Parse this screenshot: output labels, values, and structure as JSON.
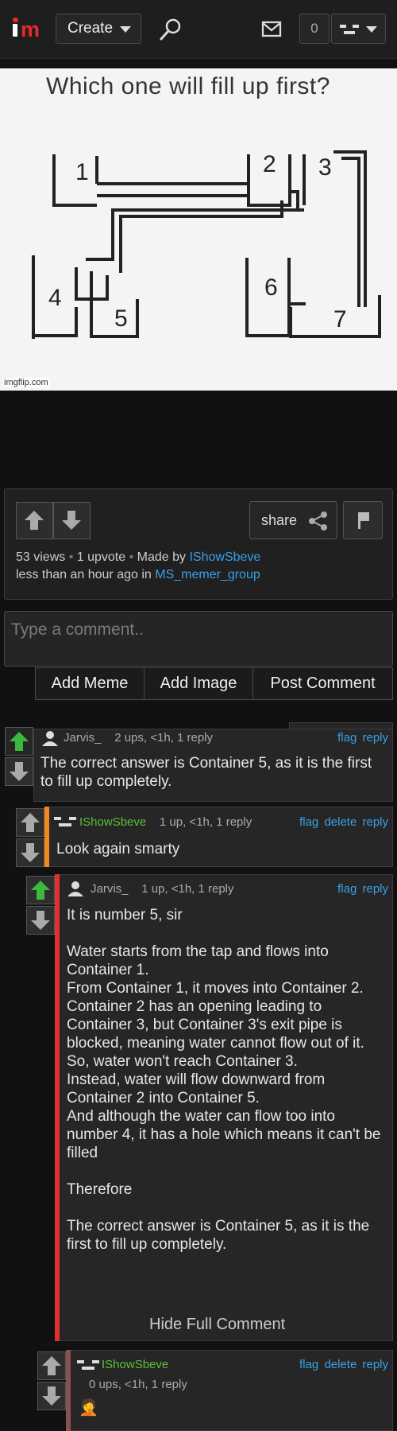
{
  "topbar": {
    "create_label": "Create",
    "notifications_count": "0"
  },
  "meme": {
    "title": "Which one will fill up first?",
    "watermark": "imgflip.com",
    "container_numbers": [
      "1",
      "2",
      "3",
      "4",
      "5",
      "6",
      "7"
    ]
  },
  "post_info": {
    "share_label": "share",
    "views": "53 views",
    "upvotes": "1 upvote",
    "made_by_prefix": "Made by",
    "author": "IShowSbeve",
    "time_prefix": "less than an hour ago in",
    "stream": "MS_memer_group"
  },
  "comment_box": {
    "placeholder": "Type a comment..",
    "add_meme": "Add Meme",
    "add_image": "Add Image",
    "post_comment": "Post Comment"
  },
  "comments": [
    {
      "user": "Jarvis_",
      "meta": "2 ups, <1h, 1 reply",
      "actions": [
        "flag",
        "reply"
      ],
      "text": "The correct answer is Container 5, as it is the first to fill up completely."
    },
    {
      "user": "IShowSbeve",
      "meta": "1 up, <1h, 1 reply",
      "actions": [
        "flag",
        "delete",
        "reply"
      ],
      "text": "Look again smarty"
    },
    {
      "user": "Jarvis_",
      "meta": "1 up, <1h, 1 reply",
      "actions": [
        "flag",
        "reply"
      ],
      "text": "It is number 5, sir\n\nWater starts from the tap and flows into Container 1.\nFrom Container 1, it moves into Container 2.\nContainer 2 has an opening leading to Container 3, but Container 3's exit pipe is blocked, meaning water cannot flow out of it. So, water won't reach Container 3.\nInstead, water will flow downward from Container 2 into Container 5.\nAnd although the water can flow too into number 4, it has a hole which means it can't be filled\n\nTherefore\n\nThe correct answer is Container 5, as it is the first to fill up completely.",
      "hide_label": "Hide Full Comment"
    },
    {
      "user": "IShowSbeve",
      "meta": "0 ups, <1h, 1 reply",
      "actions": [
        "flag",
        "delete",
        "reply"
      ],
      "text": "🤦"
    }
  ],
  "colors": {
    "accent_link": "#3aa0e8",
    "upvoted_arrow": "#3cb83c",
    "thread_bar_orange": "#f08a1c",
    "thread_bar_red": "#e03030",
    "thread_bar_brown": "#8a5050",
    "logo_red": "#e8282d"
  }
}
